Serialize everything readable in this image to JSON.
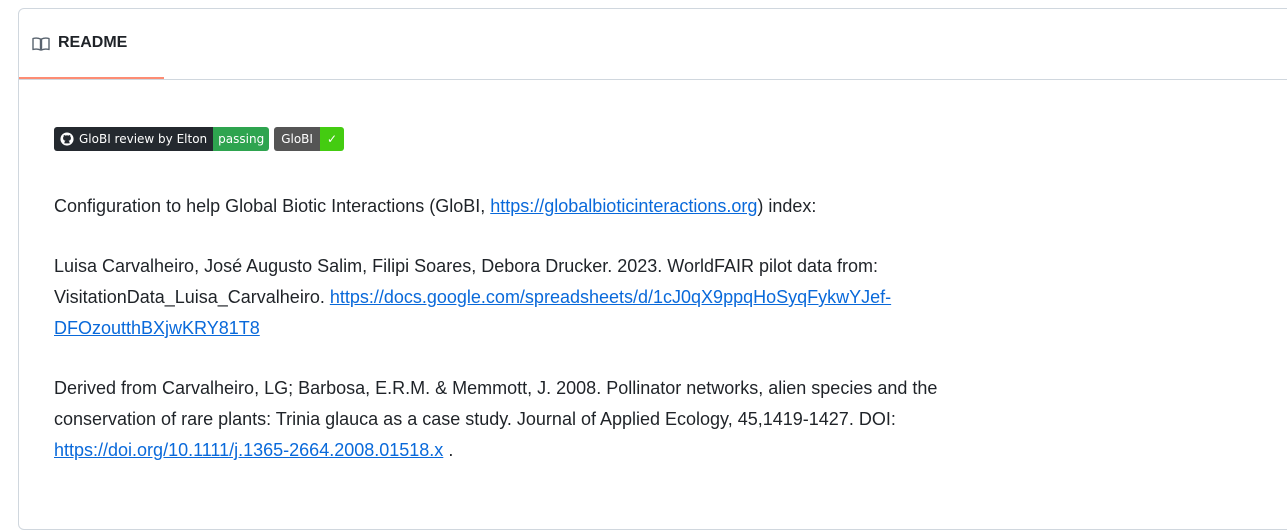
{
  "tab": {
    "label": "README"
  },
  "badges": [
    {
      "left": "GloBI review by Elton",
      "right": "passing"
    },
    {
      "left": "GloBI",
      "right": "✓"
    }
  ],
  "content": {
    "p1_pre": "Configuration to help Global Biotic Interactions (GloBI, ",
    "p1_link": "https://globalbioticinteractions.org",
    "p1_post": ") index:",
    "p2_line1": "Luisa Carvalheiro, José Augusto Salim, Filipi Soares, Debora Drucker. 2023. WorldFAIR pilot data from:",
    "p2_line2_text": "VisitationData_Luisa_Carvalheiro. ",
    "p2_link_part1": "https://docs.google.com/spreadsheets/d/1cJ0qX9ppqHoSyqFykwYJef-",
    "p2_link_part2": "DFOzoutthBXjwKRY81T8",
    "p3_line1": "Derived from Carvalheiro, LG; Barbosa, E.R.M. & Memmott, J. 2008. Pollinator networks, alien species and the",
    "p3_line2": "conservation of rare plants: Trinia glauca as a case study. Journal of Applied Ecology, 45,1419-1427. DOI:",
    "p3_link": "https://doi.org/10.1111/j.1365-2664.2008.01518.x",
    "p3_post": " ."
  }
}
